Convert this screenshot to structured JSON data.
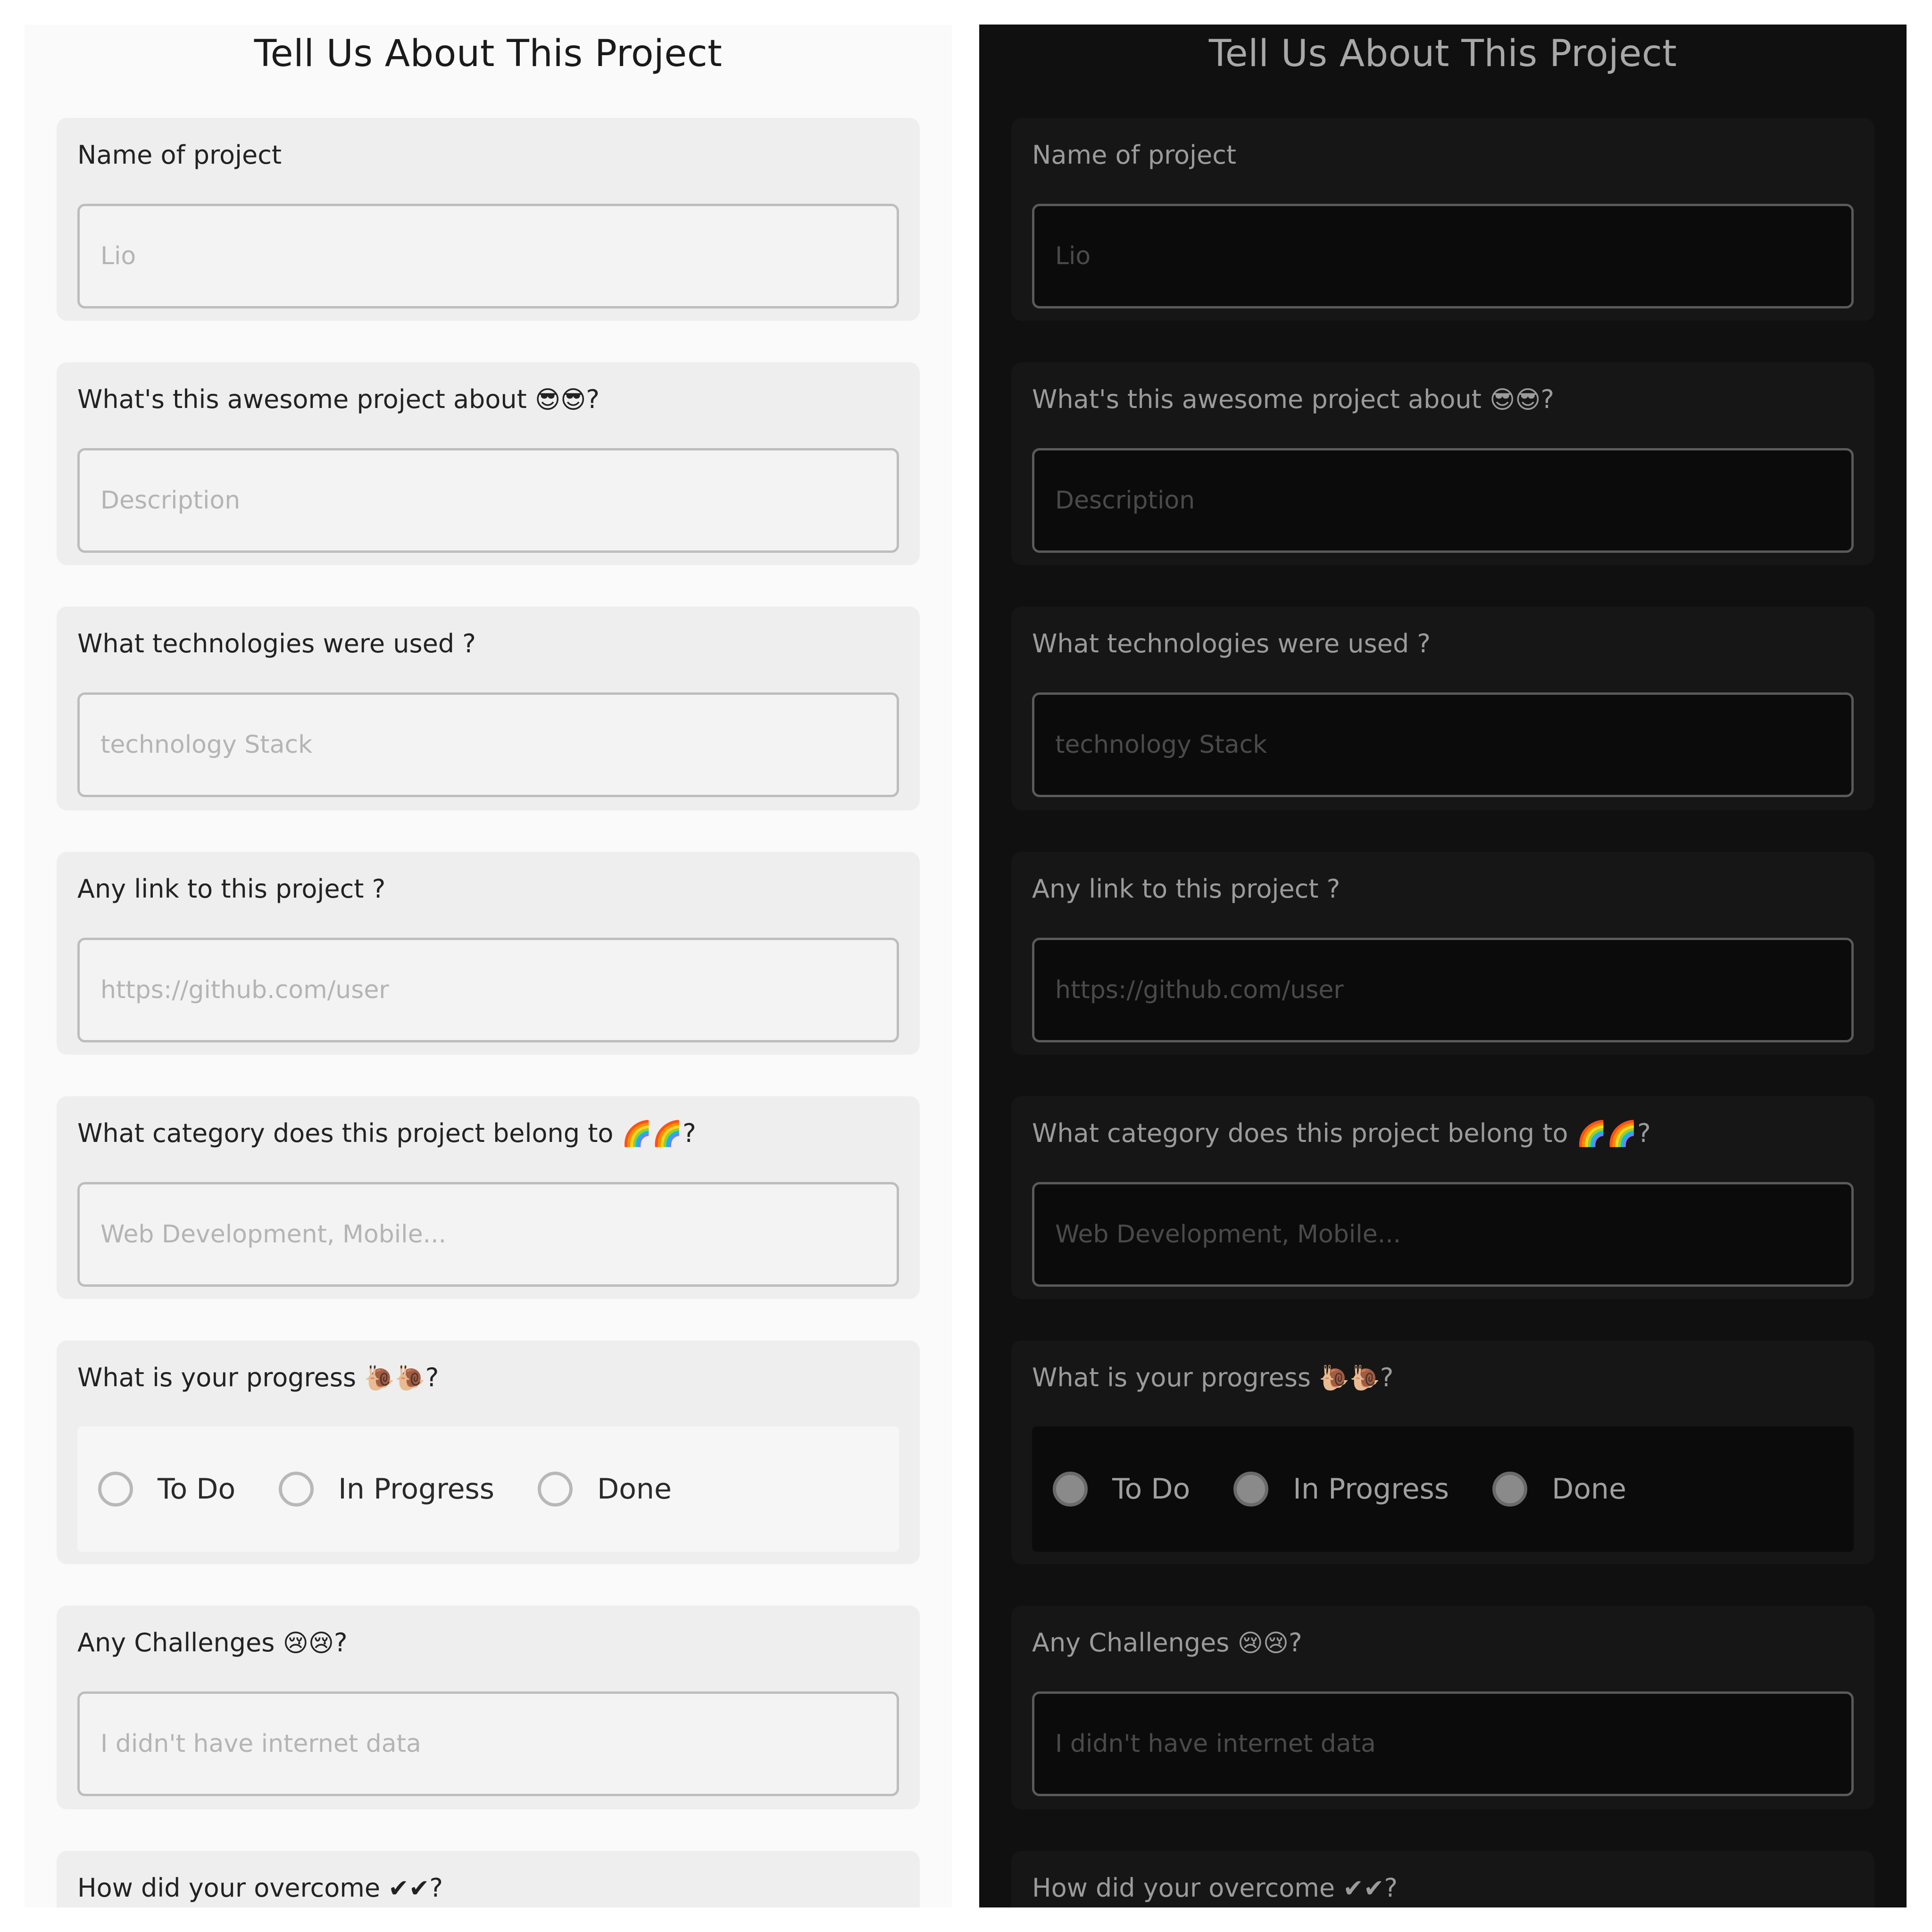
{
  "title": "Tell Us About This Project",
  "questions": {
    "name": {
      "label": "Name of project",
      "placeholder": "Lio"
    },
    "description": {
      "label": "What's this awesome project about",
      "emoji": "😎😎",
      "suffix": "?",
      "placeholder": "Description"
    },
    "technologies": {
      "label": "What technologies were used ?",
      "placeholder": "technology Stack"
    },
    "link": {
      "label": "Any link to this project ?",
      "placeholder": "https://github.com/user"
    },
    "category": {
      "label": "What category does this project belong to",
      "emoji": "🌈🌈",
      "suffix": "?",
      "placeholder": "Web Development, Mobile..."
    },
    "progress": {
      "label": "What is your progress",
      "emoji": "🐌🐌",
      "suffix": "?",
      "options": [
        "To Do",
        "In Progress",
        "Done"
      ]
    },
    "challenges": {
      "label": "Any Challenges",
      "emoji": "😢😢",
      "suffix": "?",
      "placeholder": "I didn't have internet data"
    },
    "overcome": {
      "label": "How did your overcome",
      "emoji": "✔✔",
      "suffix": "?"
    }
  },
  "colors": {
    "light_background": "#fafafa",
    "light_card": "#eeeeee",
    "dark_background": "#101010",
    "dark_card": "#161616"
  }
}
